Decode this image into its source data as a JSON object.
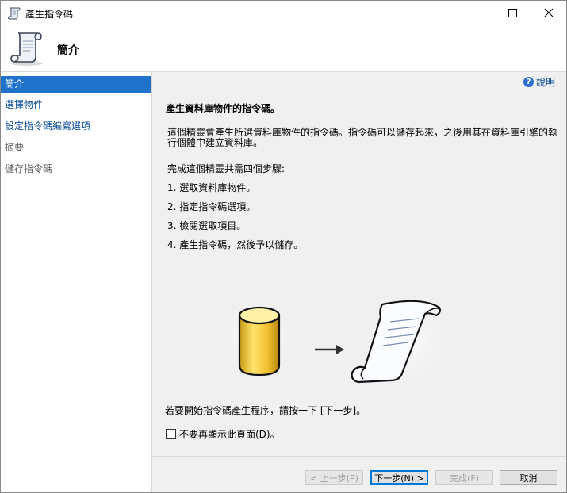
{
  "window": {
    "title": "產生指令碼"
  },
  "header": {
    "title": "簡介"
  },
  "sidebar": {
    "items": [
      {
        "label": "簡介",
        "state": "active"
      },
      {
        "label": "選擇物件",
        "state": "link"
      },
      {
        "label": "設定指令碼編寫選項",
        "state": "link"
      },
      {
        "label": "摘要",
        "state": "disabled"
      },
      {
        "label": "儲存指令碼",
        "state": "disabled"
      }
    ]
  },
  "content": {
    "help_label": "說明",
    "heading": "產生資料庫物件的指令碼。",
    "description": "這個精靈會產生所選資料庫物件的指令碼。指令碼可以儲存起來，之後用其在資料庫引擎的執行個體中建立資料庫。",
    "steps_intro": "完成這個精靈共需四個步驟:",
    "steps": [
      "1. 選取資料庫物件。",
      "2. 指定指令碼選項。",
      "3. 檢閱選取項目。",
      "4. 產生指令碼，然後予以儲存。"
    ],
    "start_text": "若要開始指令碼產生程序，請按一下 [下一步]。",
    "checkbox_label": "不要再顯示此頁面(D)。",
    "checkbox_checked": false
  },
  "buttons": {
    "back": "< 上一步(P)",
    "next": "下一步(N) >",
    "finish": "完成(F)",
    "cancel": "取消"
  },
  "colors": {
    "accent": "#1e72c9",
    "link": "#0b4b94",
    "content_bg": "#f0f0f0"
  }
}
